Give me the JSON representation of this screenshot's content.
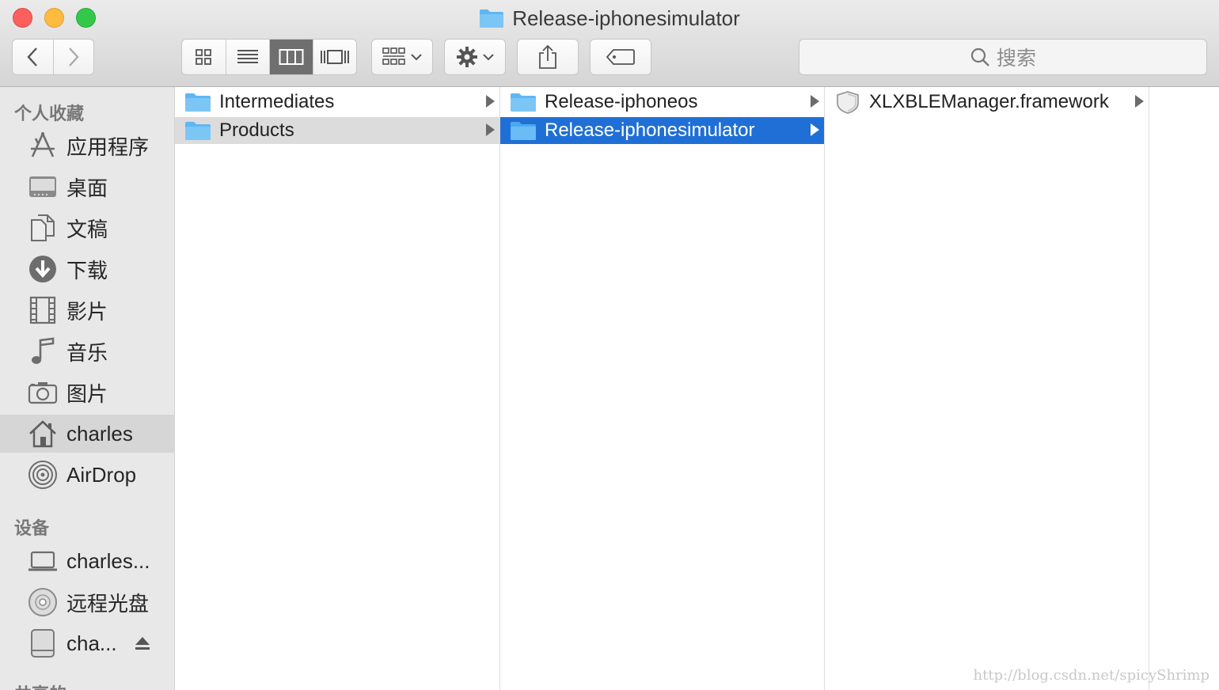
{
  "window": {
    "title": "Release-iphonesimulator"
  },
  "toolbar": {
    "back_icon": "chevron-left-icon",
    "forward_icon": "chevron-right-icon",
    "view_modes": [
      "icon-view",
      "list-view",
      "column-view",
      "cover-flow-view"
    ],
    "active_view": "column-view",
    "search_placeholder": "搜索"
  },
  "sidebar": {
    "favorites_header": "个人收藏",
    "favorites": [
      {
        "label": "应用程序",
        "icon": "applications-icon"
      },
      {
        "label": "桌面",
        "icon": "desktop-icon"
      },
      {
        "label": "文稿",
        "icon": "documents-icon"
      },
      {
        "label": "下载",
        "icon": "downloads-icon"
      },
      {
        "label": "影片",
        "icon": "movies-icon"
      },
      {
        "label": "音乐",
        "icon": "music-icon"
      },
      {
        "label": "图片",
        "icon": "pictures-icon"
      },
      {
        "label": "charles",
        "icon": "home-icon",
        "selected": true
      },
      {
        "label": "AirDrop",
        "icon": "airdrop-icon"
      }
    ],
    "devices_header": "设备",
    "devices": [
      {
        "label": "charles...",
        "icon": "laptop-icon"
      },
      {
        "label": "远程光盘",
        "icon": "optical-disc-icon"
      },
      {
        "label": "cha...",
        "icon": "external-drive-icon",
        "ejectable": true
      }
    ],
    "shared_header": "共享的"
  },
  "columns": [
    {
      "items": [
        {
          "name": "Intermediates",
          "type": "folder",
          "has_children": true
        },
        {
          "name": "Products",
          "type": "folder",
          "has_children": true,
          "selected": "inactive"
        }
      ]
    },
    {
      "items": [
        {
          "name": "Release-iphoneos",
          "type": "folder",
          "has_children": true
        },
        {
          "name": "Release-iphonesimulator",
          "type": "folder",
          "has_children": true,
          "selected": "active"
        }
      ]
    },
    {
      "items": [
        {
          "name": "XLXBLEManager.framework",
          "type": "framework",
          "has_children": true
        }
      ]
    }
  ],
  "colors": {
    "selection_active": "#1f6fd6",
    "selection_inactive": "#dcdcdc",
    "folder": "#5fb6f2"
  },
  "watermark": "http://blog.csdn.net/spicyShrimp"
}
